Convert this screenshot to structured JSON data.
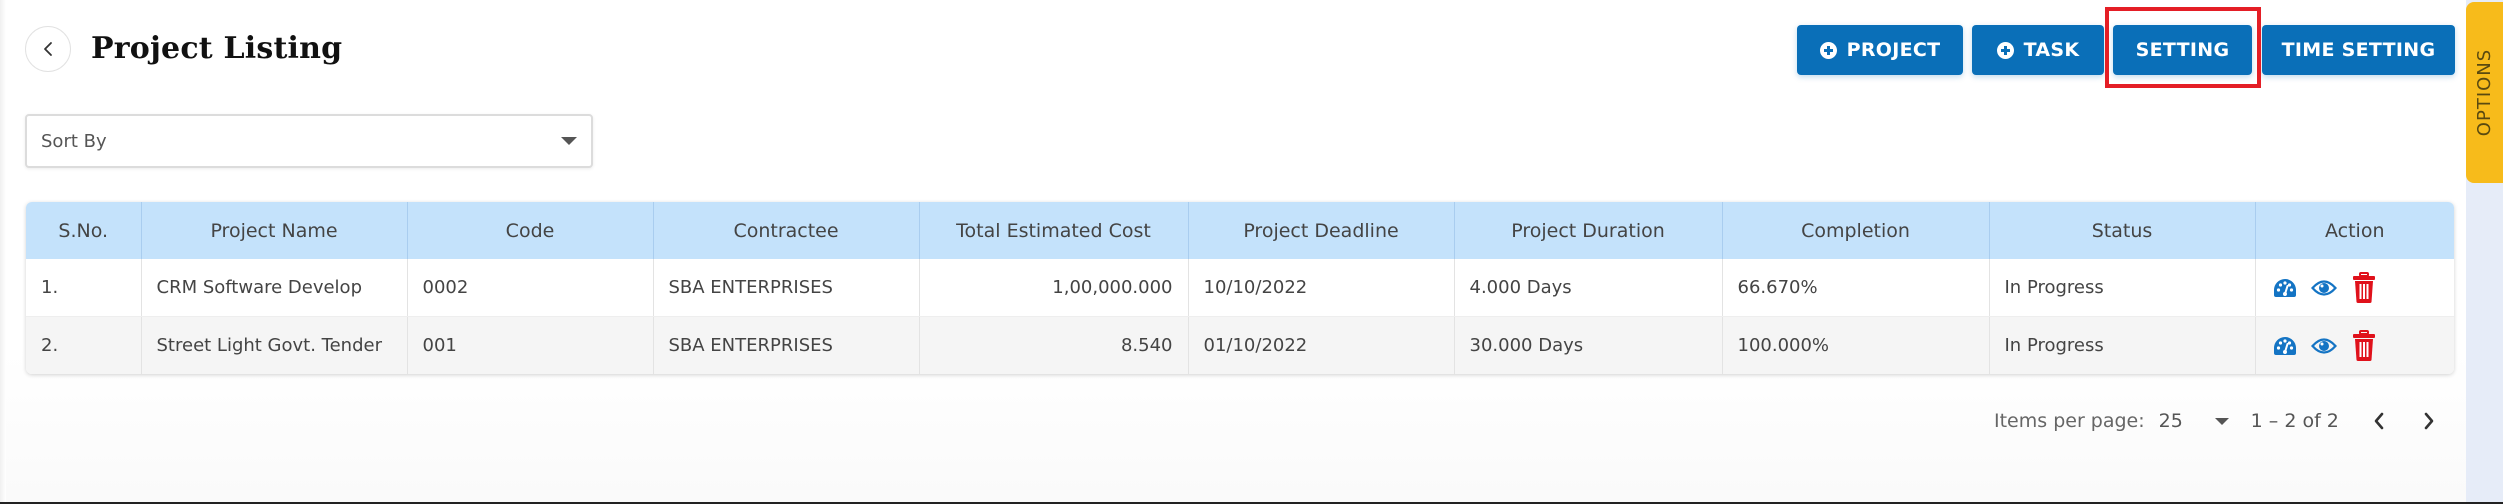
{
  "header": {
    "title": "Project Listing",
    "back_icon": "chevron-left-icon"
  },
  "toolbar": {
    "buttons": [
      {
        "label": "PROJECT",
        "icon": "plus-circle-icon"
      },
      {
        "label": "TASK",
        "icon": "plus-circle-icon"
      },
      {
        "label": "SETTING",
        "icon": null,
        "highlighted": true
      },
      {
        "label": "TIME SETTING",
        "icon": null
      }
    ],
    "highlight_color": "#e41e26",
    "button_color": "#0a6fb8"
  },
  "options_tab": {
    "label": "OPTIONS",
    "color": "#f7bb1b"
  },
  "sort": {
    "placeholder": "Sort By"
  },
  "table": {
    "columns": [
      "S.No.",
      "Project Name",
      "Code",
      "Contractee",
      "Total Estimated Cost",
      "Project Deadline",
      "Project Duration",
      "Completion",
      "Status",
      "Action"
    ],
    "rows": [
      {
        "sno": "1.",
        "project_name": "CRM Software Develop",
        "code": "0002",
        "contractee": "SBA ENTERPRISES",
        "total_estimated_cost": "1,00,000.000",
        "project_deadline": "10/10/2022",
        "project_duration": "4.000 Days",
        "completion": "66.670%",
        "status": "In Progress",
        "actions": [
          "dashboard-icon",
          "eye-icon",
          "trash-icon"
        ]
      },
      {
        "sno": "2.",
        "project_name": "Street Light Govt. Tender",
        "code": "001",
        "contractee": "SBA ENTERPRISES",
        "total_estimated_cost": "8.540",
        "project_deadline": "01/10/2022",
        "project_duration": "30.000 Days",
        "completion": "100.000%",
        "status": "In Progress",
        "actions": [
          "dashboard-icon",
          "eye-icon",
          "trash-icon"
        ]
      }
    ],
    "header_color": "#c4e2fb",
    "action_icon_color": "#1474c4",
    "delete_icon_color": "#e0111b"
  },
  "pagination": {
    "items_per_page_label": "Items per page:",
    "items_per_page": "25",
    "range": "1 – 2 of 2",
    "prev_icon": "chevron-left-icon",
    "next_icon": "chevron-right-icon"
  }
}
